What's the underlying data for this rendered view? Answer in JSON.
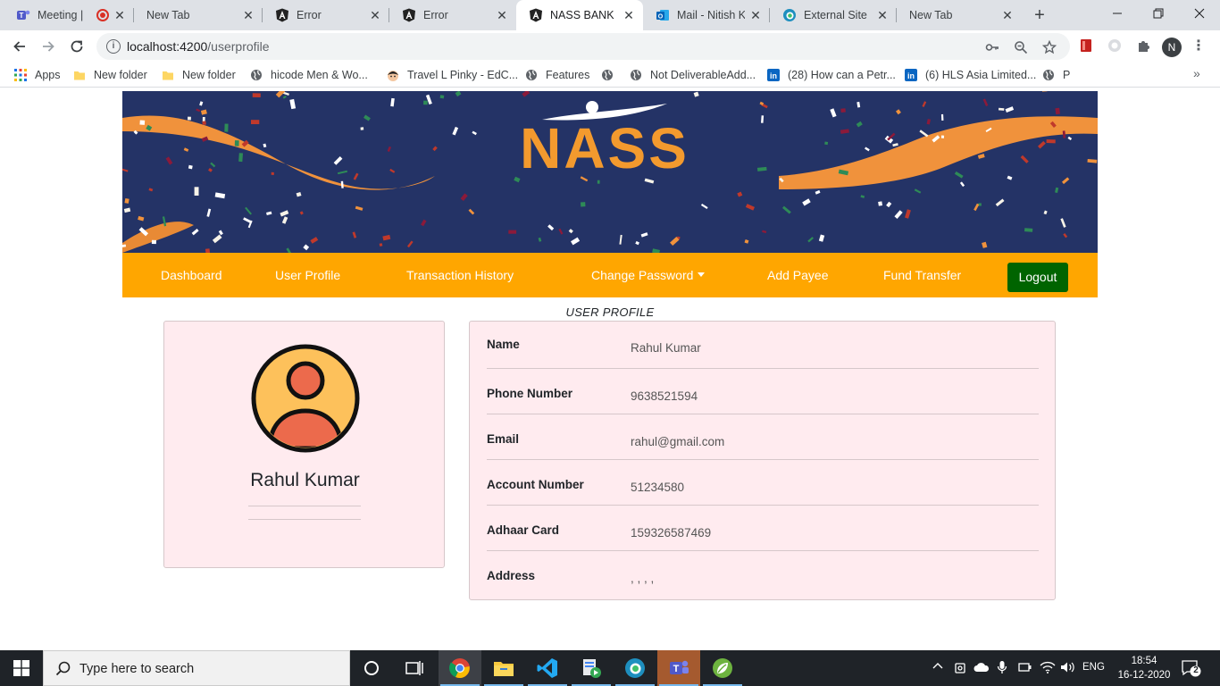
{
  "browser": {
    "tabs": [
      {
        "title": "Meeting |",
        "icon": "teams-icon",
        "active": false
      },
      {
        "title": "New Tab",
        "icon": "none",
        "active": false
      },
      {
        "title": "Error",
        "icon": "angular-icon",
        "active": false
      },
      {
        "title": "Error",
        "icon": "angular-icon",
        "active": false
      },
      {
        "title": "NASS BANK",
        "icon": "angular-icon",
        "active": true
      },
      {
        "title": "Mail - Nitish K",
        "icon": "outlook-icon",
        "active": false
      },
      {
        "title": "External Site",
        "icon": "edge-icon",
        "active": false
      },
      {
        "title": "New Tab",
        "icon": "none",
        "active": false
      }
    ],
    "url_host": "localhost:4200",
    "url_path": "/userprofile",
    "profile_initial": "N",
    "bookmarks": [
      {
        "label": "Apps",
        "icon": "apps-grid-icon"
      },
      {
        "label": "New folder",
        "icon": "folder-icon"
      },
      {
        "label": "New folder",
        "icon": "folder-icon"
      },
      {
        "label": "hicode Men & Wo...",
        "icon": "globe-icon"
      },
      {
        "label": "Travel L Pinky - EdC...",
        "icon": "avatar-icon"
      },
      {
        "label": "Features",
        "icon": "globe-icon"
      },
      {
        "label": "",
        "icon": "globe-icon"
      },
      {
        "label": "Not DeliverableAdd...",
        "icon": "globe-icon"
      },
      {
        "label": "(28) How can a Petr...",
        "icon": "linkedin-icon"
      },
      {
        "label": "(6) HLS Asia Limited...",
        "icon": "linkedin-icon"
      },
      {
        "label": "P",
        "icon": "globe-icon"
      }
    ]
  },
  "banner": {
    "brand": "NASS"
  },
  "nav": {
    "items": [
      "Dashboard",
      "User Profile",
      "Transaction History",
      "Change Password",
      "Add Payee",
      "Fund Transfer"
    ],
    "logout": "Logout"
  },
  "profile": {
    "section_title": "USER PROFILE",
    "name": "Rahul Kumar",
    "fields": [
      {
        "label": "Name",
        "value": "Rahul Kumar"
      },
      {
        "label": "Phone Number",
        "value": "9638521594"
      },
      {
        "label": "Email",
        "value": "rahul@gmail.com"
      },
      {
        "label": "Account Number",
        "value": "51234580"
      },
      {
        "label": "Adhaar Card",
        "value": "159326587469"
      },
      {
        "label": "Address",
        "value": ", , , ,"
      }
    ]
  },
  "taskbar": {
    "search_placeholder": "Type here to search",
    "language": "ENG",
    "time": "18:54",
    "date": "16-12-2020",
    "notification_count": "2"
  }
}
